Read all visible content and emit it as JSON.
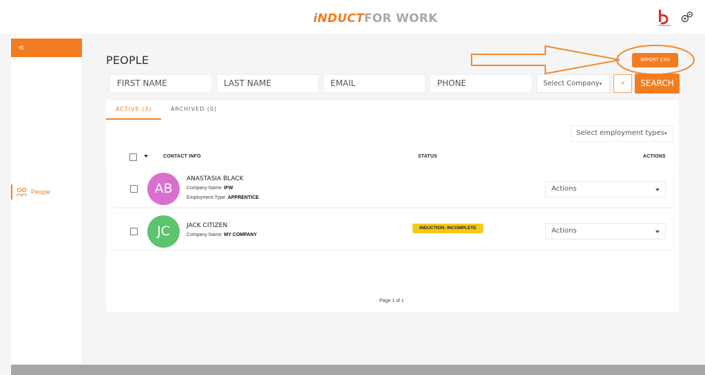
{
  "header": {
    "logo_part1": "iNDUCT",
    "logo_part2": "FOR WORK",
    "brand_icon": "brand-logo-icon",
    "settings_icon": "gear-icon"
  },
  "sidebar": {
    "collapse_label": "«",
    "items": [
      {
        "label": "People",
        "icon": "people-icon",
        "active": true
      }
    ]
  },
  "page": {
    "title": "PEOPLE",
    "import_label": "IMPORT CSV"
  },
  "filters": {
    "first_name": "FIRST NAME",
    "last_name": "LAST NAME",
    "email": "EMAIL",
    "phone": "PHONE",
    "company_select": "Select Company",
    "clear_label": "×",
    "search_label": "SEARCH"
  },
  "tabs": [
    {
      "label": "ACTIVE (3)",
      "active": true
    },
    {
      "label": "ARCHIVED (0)",
      "active": false
    }
  ],
  "employment_select": "Select employment types",
  "table": {
    "headers": {
      "contact": "CONTACT INFO",
      "status": "STATUS",
      "actions": "ACTIONS"
    },
    "rows": [
      {
        "initials": "AB",
        "avatar_color": "#db6fcf",
        "name": "ANASTASIA BLACK",
        "company_label": "Company Name:",
        "company": "IFW",
        "employment_label": "Employment Type:",
        "employment": "APPRENTICE",
        "status": "",
        "actions": "Actions"
      },
      {
        "initials": "JC",
        "avatar_color": "#5cc46e",
        "name": "JACK CITIZEN",
        "company_label": "Company Name:",
        "company": "MY COMPANY",
        "status": "INDUCTION: INCOMPLETE",
        "actions": "Actions"
      }
    ]
  },
  "pager": "Page 1 of 1",
  "colors": {
    "accent": "#f47c20",
    "badge": "#f6c81a"
  }
}
